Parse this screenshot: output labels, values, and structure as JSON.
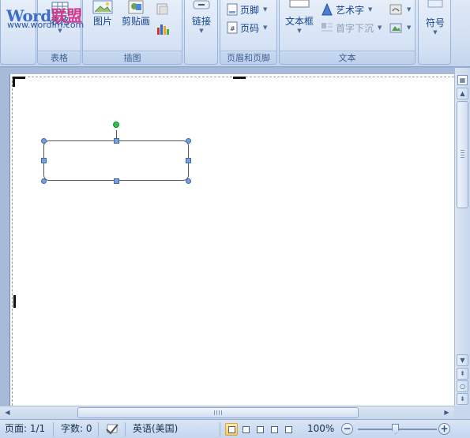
{
  "logo": {
    "brand_latin": "Word",
    "brand_cn": "联盟",
    "url": "www.wordlm.com"
  },
  "ribbon": {
    "groups": {
      "table": {
        "label": "表格",
        "button": "表格"
      },
      "illustrations": {
        "label": "插图",
        "picture": "图片",
        "clipart": "剪贴画"
      },
      "links": {
        "button": "链接"
      },
      "header_footer": {
        "label": "页眉和页脚",
        "footer": "页脚",
        "page_number": "页码"
      },
      "text": {
        "label": "文本",
        "textbox": "文本框",
        "wordart": "艺术字",
        "dropcap": "首字下沉"
      },
      "symbols": {
        "button": "符号"
      }
    }
  },
  "status": {
    "page": "页面: 1/1",
    "words": "字数: 0",
    "language": "英语(美国)",
    "zoom": "100%",
    "zoom_minus": "−",
    "zoom_plus": "+"
  },
  "colors": {
    "ribbon_bg": "#d3e1f3",
    "rotation_handle": "#2cc24a",
    "selection_handle": "#7aa0d8",
    "active_view": "#ffc95a"
  },
  "icons": {
    "scroll_up": "▲",
    "scroll_down": "▼",
    "scroll_left": "◀",
    "scroll_right": "▶",
    "prev_page": "⇞",
    "browse_object": "○",
    "next_page": "⇟"
  }
}
